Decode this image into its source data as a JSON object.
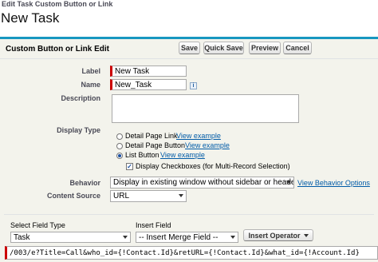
{
  "breadcrumb": "Edit Task Custom Button or Link",
  "page_title": "New Task",
  "section_title": "Custom Button or Link Edit",
  "buttons": {
    "save": "Save",
    "quick_save": "Quick Save",
    "preview": "Preview",
    "cancel": "Cancel"
  },
  "form": {
    "label_label": "Label",
    "label_value": "New Task",
    "name_label": "Name",
    "name_value": "New_Task",
    "info_icon": "i",
    "description_label": "Description",
    "description_value": "",
    "display_type_label": "Display Type",
    "display_type_options": [
      {
        "label": "Detail Page Link",
        "link": "View example",
        "selected": false
      },
      {
        "label": "Detail Page Button",
        "link": "View example",
        "selected": false
      },
      {
        "label": "List Button",
        "link": "View example",
        "selected": true
      }
    ],
    "display_checkboxes_label": "Display Checkboxes (for Multi-Record Selection)",
    "display_checkboxes_checked": true,
    "behavior_label": "Behavior",
    "behavior_value": "Display in existing window without sidebar or header",
    "behavior_link": "View Behavior Options",
    "content_source_label": "Content Source",
    "content_source_value": "URL"
  },
  "editor": {
    "select_field_type_label": "Select Field Type",
    "select_field_type_value": "Task",
    "insert_field_label": "Insert Field",
    "insert_field_value": "-- Insert Merge Field --",
    "insert_operator_label": "Insert Operator",
    "formula": "/003/e?Title=Call&who_id={!Contact.Id}&retURL={!Contact.Id}&what_id={!Account.Id}"
  },
  "colors": {
    "accent": "#1797c0",
    "required": "#cc0000",
    "link": "#015ba7",
    "panel_bg": "#f3f3ec"
  }
}
